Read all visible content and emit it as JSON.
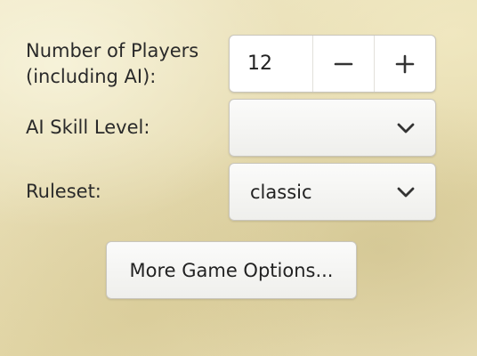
{
  "players": {
    "label_line1": "Number of Players",
    "label_line2": "(including AI):",
    "value": "12",
    "decrement_icon": "minus-icon",
    "increment_icon": "plus-icon"
  },
  "ai_skill": {
    "label": "AI Skill Level:",
    "selected": "",
    "icon": "chevron-down-icon"
  },
  "ruleset": {
    "label": "Ruleset:",
    "selected": "classic",
    "icon": "chevron-down-icon"
  },
  "more_options": {
    "label": "More Game Options..."
  },
  "colors": {
    "background": "#e6dbb0",
    "control_bg": "#ffffff",
    "control_border": "#c9c6bd",
    "text": "#222222"
  }
}
